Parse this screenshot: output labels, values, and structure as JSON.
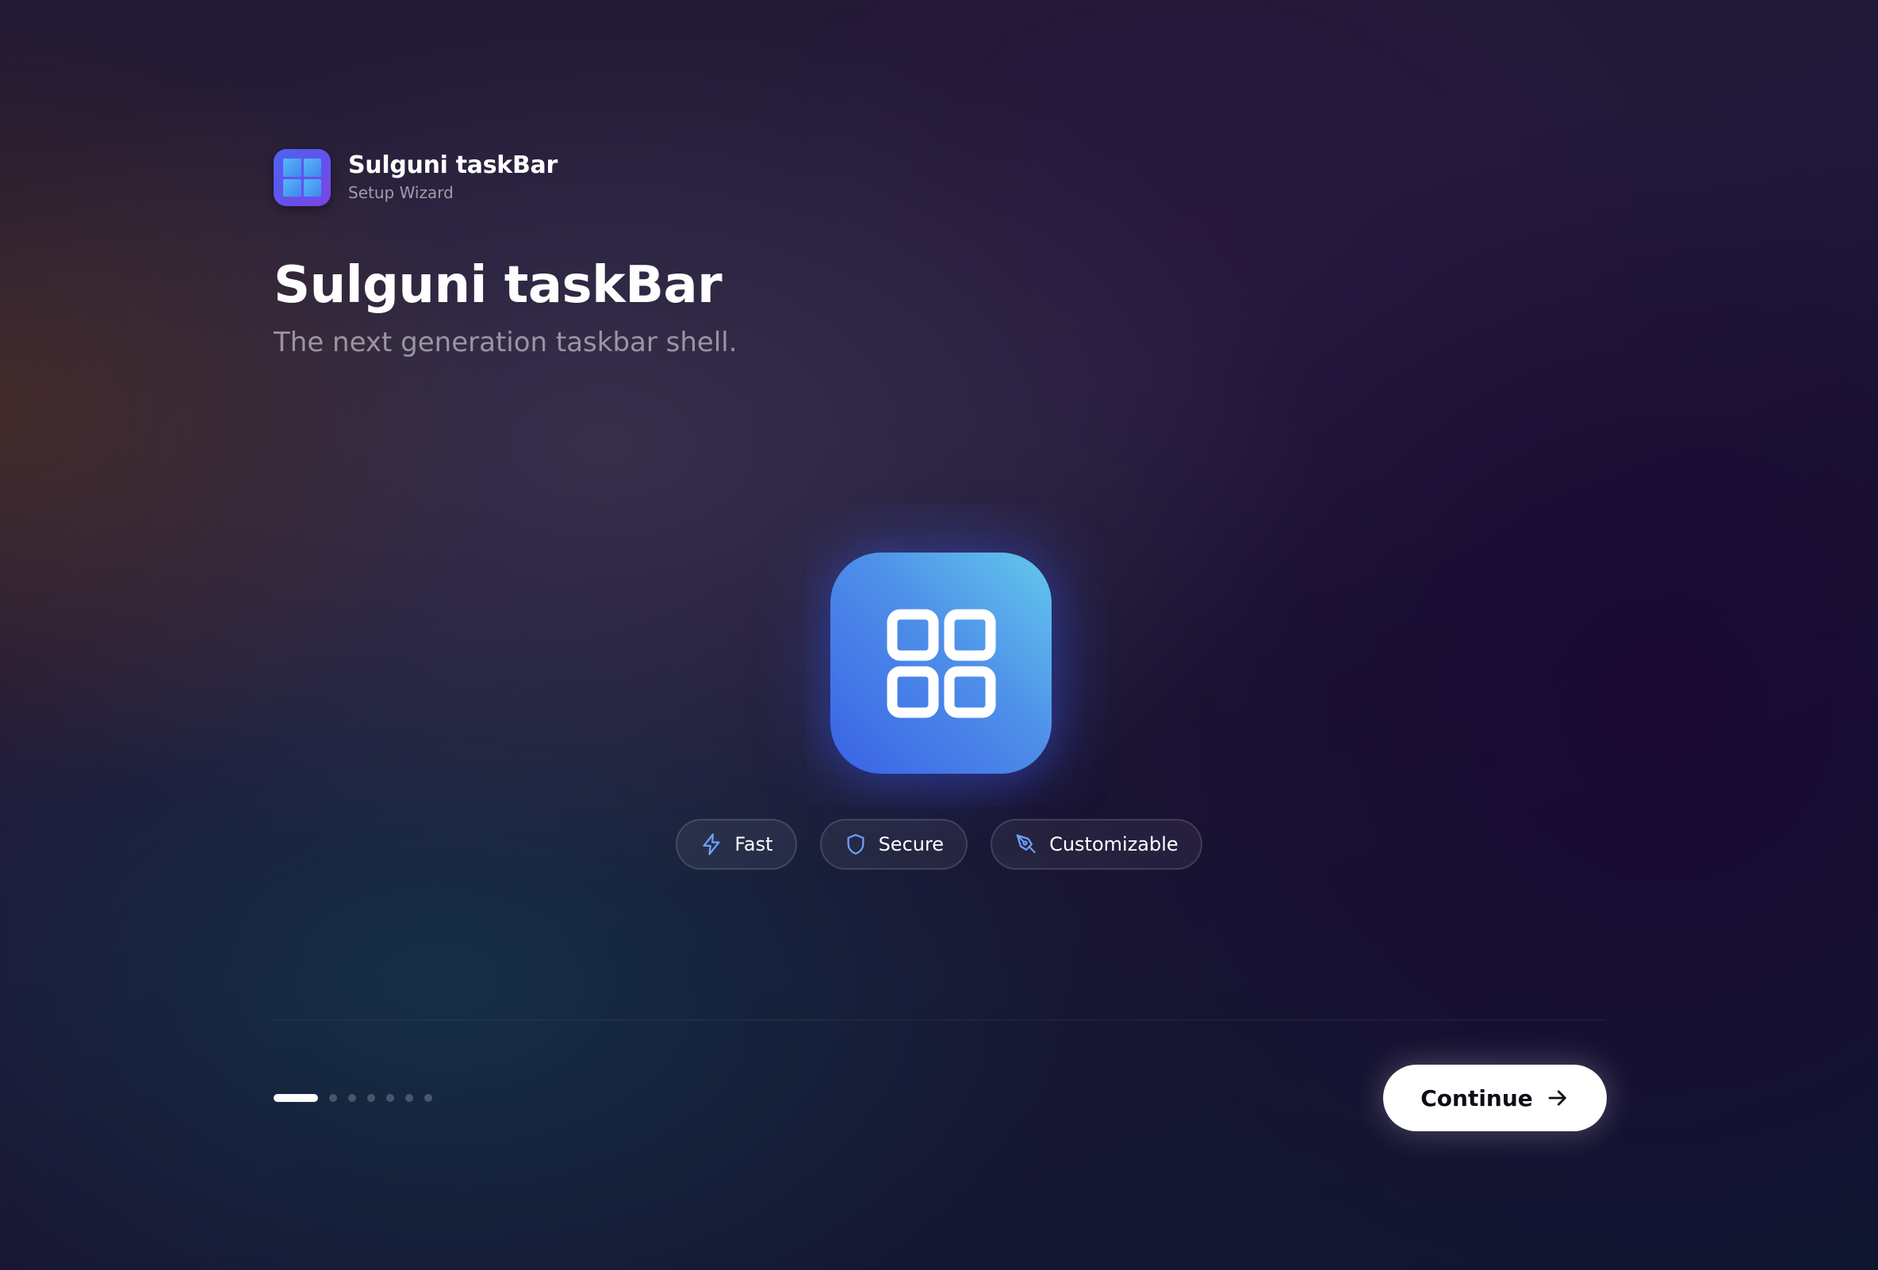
{
  "brand": {
    "name": "Sulguni taskBar",
    "subtitle": "Setup Wizard",
    "icon": "windows-grid-icon"
  },
  "hero": {
    "title": "Sulguni taskBar",
    "subtitle": "The next generation taskbar shell.",
    "app_icon": "four-squares-grid-icon"
  },
  "features": [
    {
      "label": "Fast",
      "icon": "lightning-icon"
    },
    {
      "label": "Secure",
      "icon": "shield-icon"
    },
    {
      "label": "Customizable",
      "icon": "pen-icon"
    }
  ],
  "progress": {
    "current_step": 1,
    "total_steps": 7
  },
  "footer": {
    "continue_label": "Continue",
    "continue_icon": "arrow-right-icon"
  },
  "colors": {
    "accent": "#4a7cf0",
    "icon_gradient_start": "#3a62e6",
    "icon_gradient_end": "#62c8ec",
    "pill_icon": "#6ea0ff",
    "button_bg": "#ffffff"
  }
}
